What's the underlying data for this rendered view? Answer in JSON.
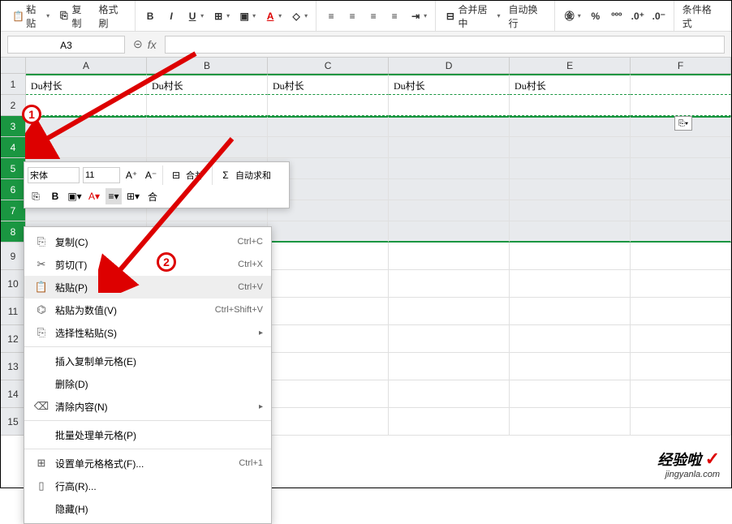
{
  "toolbar": {
    "paste": "粘贴",
    "copy": "复制",
    "format_painter": "格式刷",
    "merge_center": "合并居中",
    "wrap_text": "自动换行",
    "cond_format": "条件格式"
  },
  "formula_bar": {
    "name_box": "A3"
  },
  "columns": [
    "A",
    "B",
    "C",
    "D",
    "E",
    "F"
  ],
  "rows_visible": [
    "1",
    "2",
    "3",
    "4",
    "5",
    "6",
    "7",
    "8",
    "9",
    "10",
    "11",
    "12",
    "13",
    "14",
    "15"
  ],
  "cells": {
    "row1": [
      "Du村长",
      "Du村长",
      "Du村长",
      "Du村长",
      "Du村长",
      ""
    ]
  },
  "mini_toolbar": {
    "font_name": "宋体",
    "font_size": "11",
    "merge": "合并",
    "autosum": "自动求和"
  },
  "context_menu": {
    "copy": {
      "label": "复制(C)",
      "key": "Ctrl+C"
    },
    "cut": {
      "label": "剪切(T)",
      "key": "Ctrl+X"
    },
    "paste": {
      "label": "粘贴(P)",
      "key": "Ctrl+V"
    },
    "paste_val": {
      "label": "粘贴为数值(V)",
      "key": "Ctrl+Shift+V"
    },
    "paste_special": {
      "label": "选择性粘贴(S)"
    },
    "insert_copied": {
      "label": "插入复制单元格(E)"
    },
    "delete": {
      "label": "删除(D)"
    },
    "clear": {
      "label": "清除内容(N)"
    },
    "batch": {
      "label": "批量处理单元格(P)"
    },
    "format_cells": {
      "label": "设置单元格格式(F)...",
      "key": "Ctrl+1"
    },
    "row_height": {
      "label": "行高(R)..."
    },
    "hide": {
      "label": "隐藏(H)"
    }
  },
  "badges": {
    "one": "1",
    "two": "2"
  },
  "watermark": {
    "title": "经验啦",
    "sub": "jingyanla.com"
  },
  "chart_data": null
}
